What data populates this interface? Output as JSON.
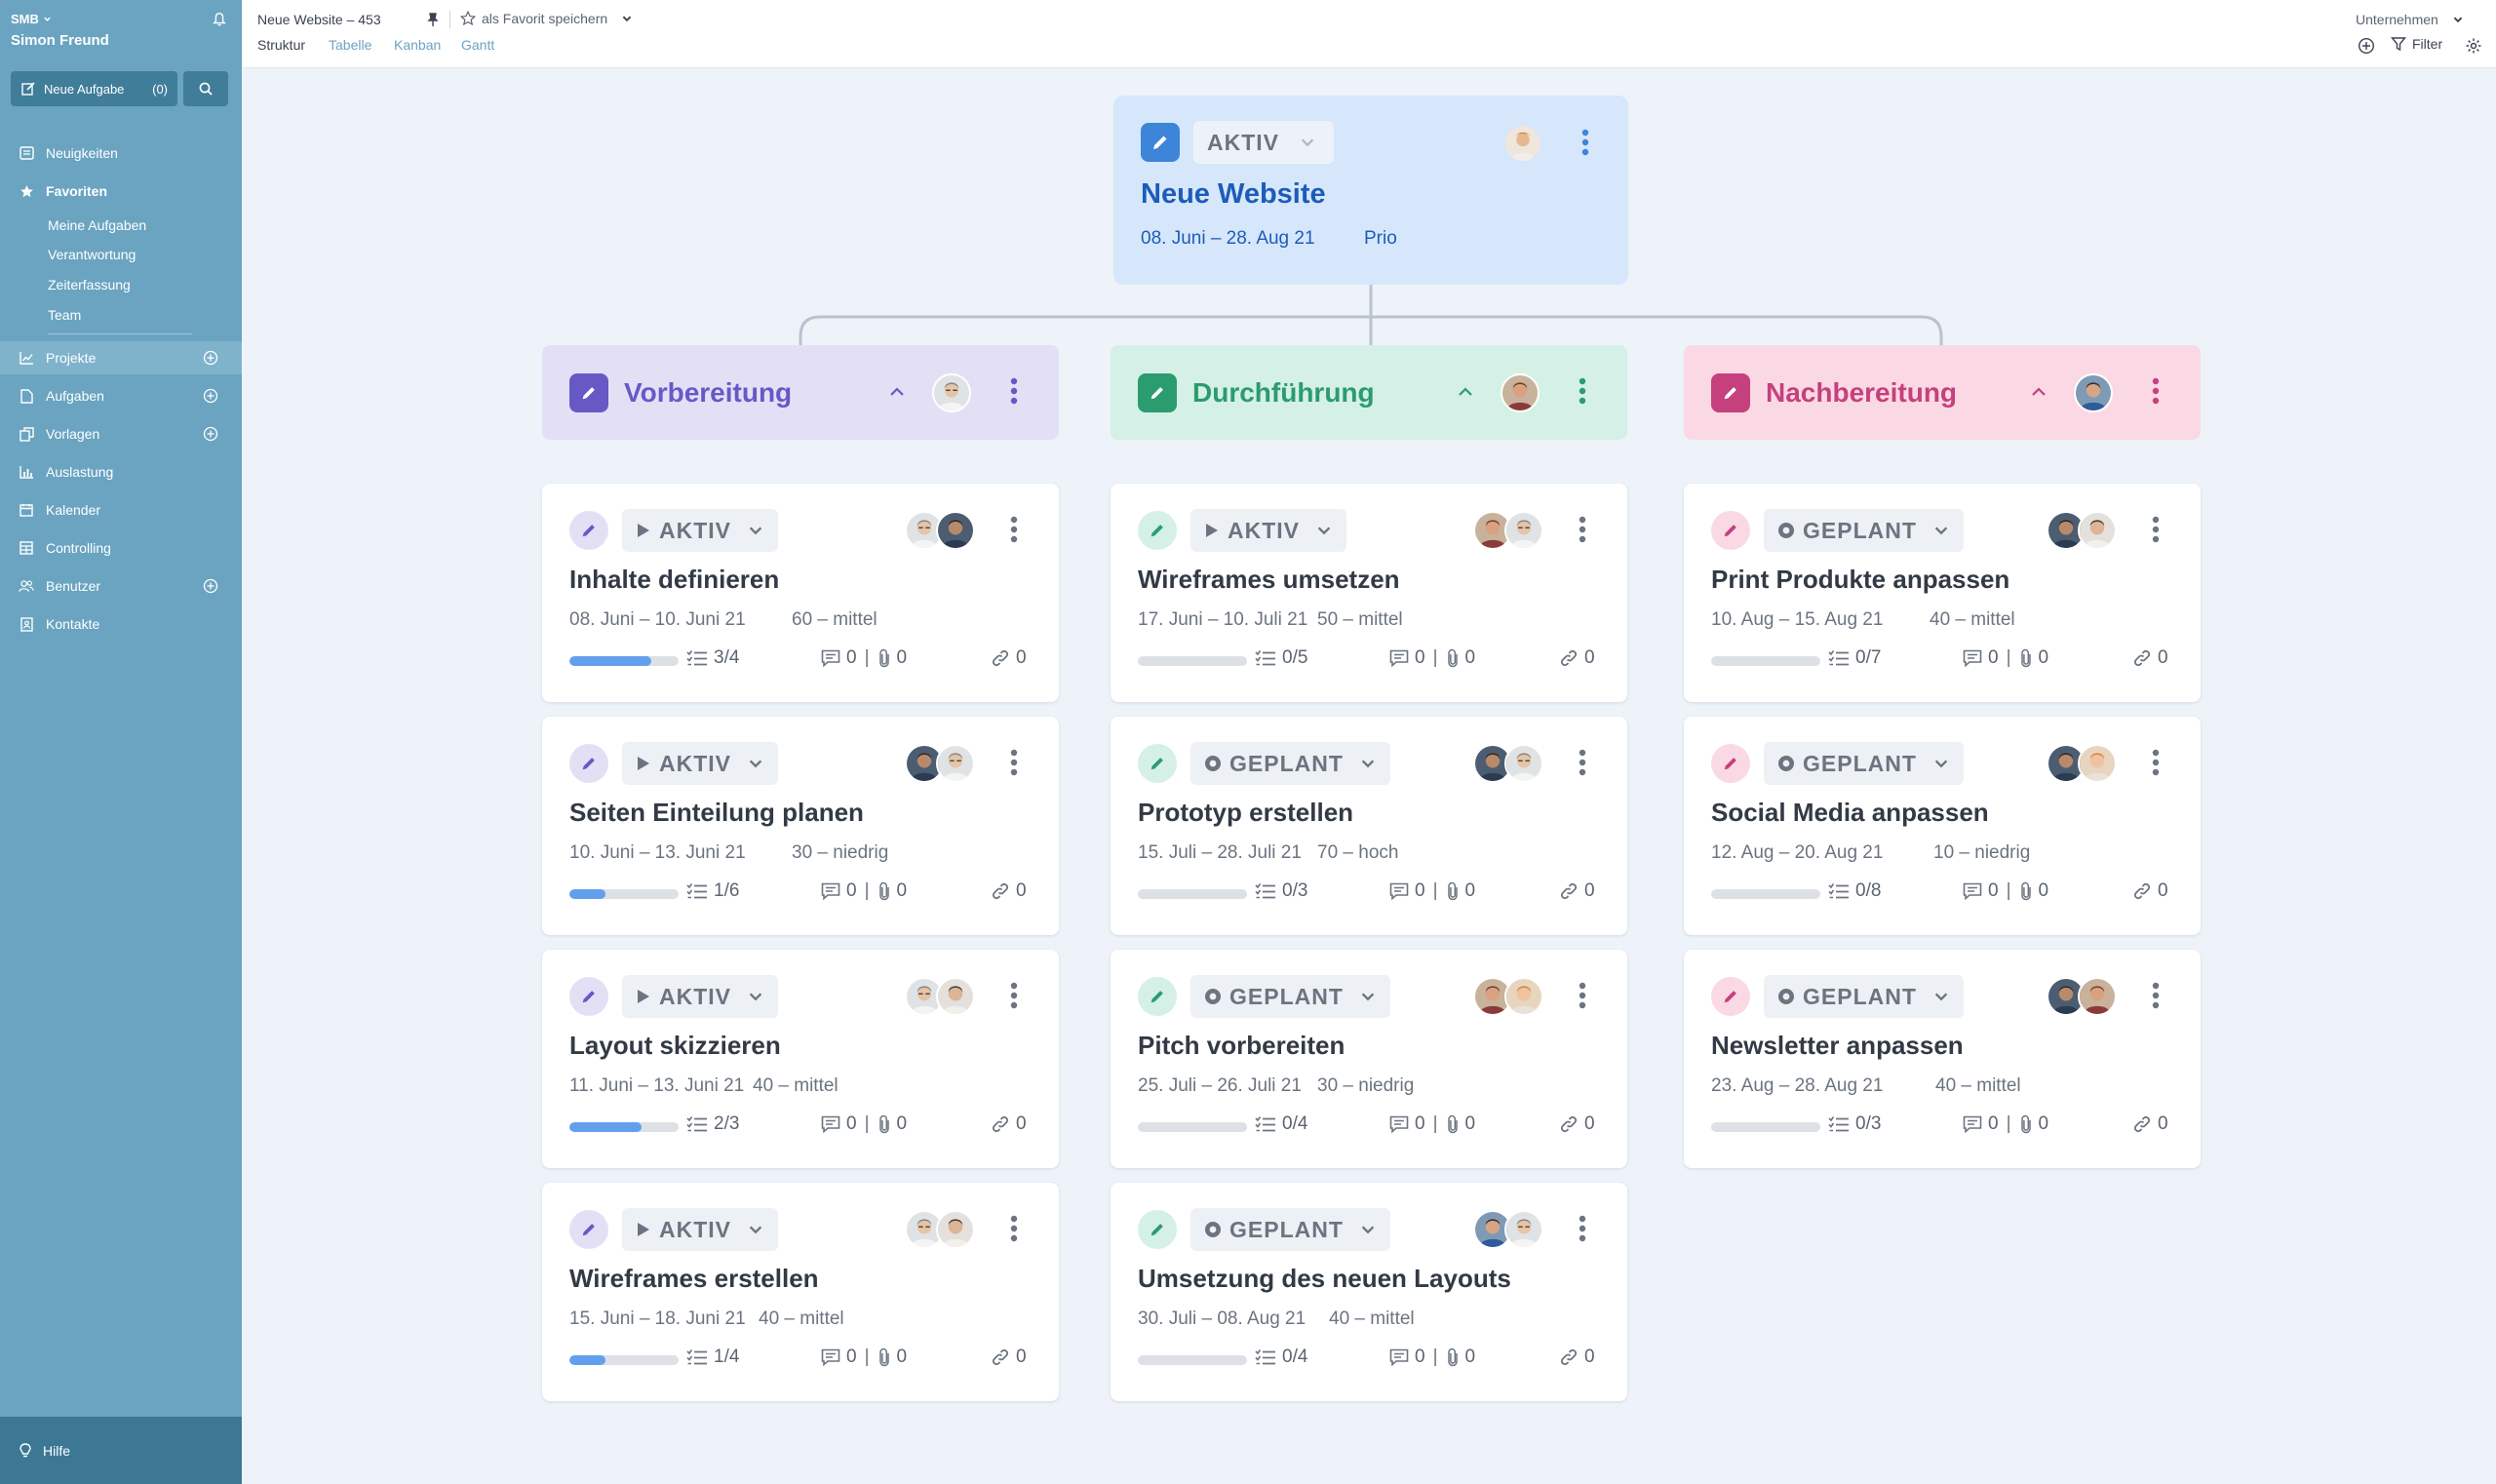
{
  "sidebar": {
    "company": "SMB",
    "user": "Simon Freund",
    "new_task_label": "Neue Aufgabe",
    "new_task_count": "(0)",
    "nav": [
      {
        "label": "Neuigkeiten",
        "icon": "news-icon"
      },
      {
        "label": "Favoriten",
        "icon": "star-icon"
      },
      {
        "label": "Projekte",
        "icon": "chart-icon"
      },
      {
        "label": "Aufgaben",
        "icon": "file-icon"
      },
      {
        "label": "Vorlagen",
        "icon": "copy-icon"
      },
      {
        "label": "Auslastung",
        "icon": "bar-chart-icon"
      },
      {
        "label": "Kalender",
        "icon": "calendar-icon"
      },
      {
        "label": "Controlling",
        "icon": "table-icon"
      },
      {
        "label": "Benutzer",
        "icon": "users-icon"
      },
      {
        "label": "Kontakte",
        "icon": "contact-icon"
      }
    ],
    "favorites": [
      "Meine Aufgaben",
      "Verantwortung",
      "Zeiterfassung",
      "Team"
    ],
    "help_label": "Hilfe"
  },
  "topbar": {
    "title": "Neue Website – 453",
    "favorite_label": "als Favorit speichern",
    "tabs": [
      "Struktur",
      "Tabelle",
      "Kanban",
      "Gantt"
    ],
    "company_label": "Unternehmen",
    "filter_label": "Filter"
  },
  "root": {
    "status": "AKTIV",
    "title": "Neue Website",
    "dates": "08. Juni – 28. Aug 21",
    "prio": "Prio"
  },
  "phases": [
    {
      "title": "Vorbereitung",
      "accent": "#6659c6",
      "bg": "#e3e0f6",
      "tasks": [
        {
          "status": "AKTIV",
          "title": "Inhalte definieren",
          "dates": "08. Juni – 10. Juni 21",
          "effort": "60 – mittel",
          "subtasks": "3/4",
          "progress": 0.75,
          "comments": "0",
          "attachments": "0",
          "links": "0"
        },
        {
          "status": "AKTIV",
          "title": "Seiten Einteilung planen",
          "dates": "10. Juni – 13. Juni 21",
          "effort": "30 – niedrig",
          "subtasks": "1/6",
          "progress": 0.33,
          "comments": "0",
          "attachments": "0",
          "links": "0"
        },
        {
          "status": "AKTIV",
          "title": "Layout skizzieren",
          "dates": "11. Juni – 13. Juni 21",
          "effort": "40 – mittel",
          "subtasks": "2/3",
          "progress": 0.66,
          "comments": "0",
          "attachments": "0",
          "links": "0"
        },
        {
          "status": "AKTIV",
          "title": "Wireframes erstellen",
          "dates": "15. Juni – 18. Juni 21",
          "effort": "40 – mittel",
          "subtasks": "1/4",
          "progress": 0.33,
          "comments": "0",
          "attachments": "0",
          "links": "0"
        }
      ]
    },
    {
      "title": "Durchführung",
      "accent": "#2a9c6f",
      "bg": "#d5f0e6",
      "tasks": [
        {
          "status": "AKTIV",
          "title": "Wireframes umsetzen",
          "dates": "17. Juni – 10. Juli 21",
          "effort": "50 – mittel",
          "subtasks": "0/5",
          "progress": 0,
          "comments": "0",
          "attachments": "0",
          "links": "0"
        },
        {
          "status": "GEPLANT",
          "title": "Prototyp erstellen",
          "dates": "15. Juli – 28. Juli 21",
          "effort": "70 – hoch",
          "subtasks": "0/3",
          "progress": 0,
          "comments": "0",
          "attachments": "0",
          "links": "0"
        },
        {
          "status": "GEPLANT",
          "title": "Pitch vorbereiten",
          "dates": "25. Juli – 26. Juli 21",
          "effort": "30 – niedrig",
          "subtasks": "0/4",
          "progress": 0,
          "comments": "0",
          "attachments": "0",
          "links": "0"
        },
        {
          "status": "GEPLANT",
          "title": "Umsetzung des neuen Layouts",
          "dates": "30. Juli – 08. Aug 21",
          "effort": "40 – mittel",
          "subtasks": "0/4",
          "progress": 0,
          "comments": "0",
          "attachments": "0",
          "links": "0"
        }
      ]
    },
    {
      "title": "Nachbereitung",
      "accent": "#c5407c",
      "bg": "#fad9e5",
      "tasks": [
        {
          "status": "GEPLANT",
          "title": "Print Produkte anpassen",
          "dates": "10. Aug – 15. Aug 21",
          "effort": "40 – mittel",
          "subtasks": "0/7",
          "progress": 0,
          "comments": "0",
          "attachments": "0",
          "links": "0"
        },
        {
          "status": "GEPLANT",
          "title": "Social Media anpassen",
          "dates": "12. Aug – 20. Aug 21",
          "effort": "10 – niedrig",
          "subtasks": "0/8",
          "progress": 0,
          "comments": "0",
          "attachments": "0",
          "links": "0"
        },
        {
          "status": "GEPLANT",
          "title": "Newsletter anpassen",
          "dates": "23. Aug – 28. Aug 21",
          "effort": "40 – mittel",
          "subtasks": "0/3",
          "progress": 0,
          "comments": "0",
          "attachments": "0",
          "links": "0"
        }
      ]
    }
  ]
}
